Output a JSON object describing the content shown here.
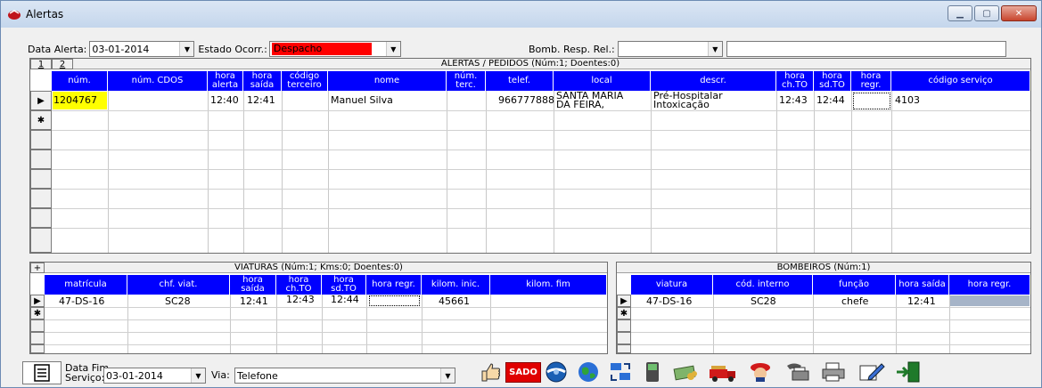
{
  "window": {
    "title": "Alertas"
  },
  "filters": {
    "data_alerta_label": "Data Alerta:",
    "data_alerta_value": "03-01-2014",
    "estado_label": "Estado Ocorr.:",
    "estado_value": "Despacho",
    "estado_color": "#ff0000",
    "bomb_label": "Bomb. Resp. Rel.:",
    "bomb_value": ""
  },
  "alertas": {
    "tabs": [
      "1",
      "2"
    ],
    "caption": "ALERTAS / PEDIDOS (Núm:1;  Doentes:0)",
    "columns": [
      "núm.",
      "núm. CDOS",
      "hora alerta",
      "hora saída",
      "código terceiro",
      "nome",
      "núm. terc.",
      "telef.",
      "local",
      "descr.",
      "hora ch.TO",
      "hora sd.TO",
      "hora regr.",
      "código serviço"
    ],
    "row": {
      "num": "1204767",
      "num_cdos": "",
      "hora_alerta": "12:40",
      "hora_saida": "12:41",
      "codigo_terceiro": "",
      "nome": "Manuel Silva",
      "num_terc": "",
      "telef": "966777888",
      "local_l1": "SANTA MARIA",
      "local_l2": "DA FEIRA,",
      "descr_l1": "Pré-Hospitalar",
      "descr_l2": "Intoxicação",
      "hora_chto": "12:43",
      "hora_sdto": "12:44",
      "hora_regr": "",
      "codigo_servico": "4103"
    }
  },
  "viaturas": {
    "toggle": "+",
    "caption": "VIATURAS (Núm:1;  Kms:0;  Doentes:0)",
    "columns": [
      "matrícula",
      "chf. viat.",
      "hora saída",
      "hora ch.TO",
      "hora sd.TO",
      "hora regr.",
      "kilom. inic.",
      "kilom. fim"
    ],
    "row": {
      "matricula": "47-DS-16",
      "chf_viat": "SC28",
      "hora_saida": "12:41",
      "hora_chto": "12:43",
      "hora_sdto": "12:44",
      "hora_regr": "",
      "kilom_inic": "45661",
      "kilom_fim": ""
    }
  },
  "bombeiros": {
    "caption": "BOMBEIROS (Núm:1)",
    "columns": [
      "viatura",
      "cód. interno",
      "função",
      "hora saída",
      "hora regr."
    ],
    "row": {
      "viatura": "47-DS-16",
      "cod_interno": "SC28",
      "funcao": "chefe",
      "hora_saida": "12:41",
      "hora_regr": ""
    }
  },
  "footer": {
    "data_fim_label_1": "Data Fim",
    "data_fim_label_2": "Serviço:",
    "data_fim_value": "03-01-2014",
    "via_label": "Via:",
    "via_value": "Telefone",
    "sado_label": "SADO"
  }
}
